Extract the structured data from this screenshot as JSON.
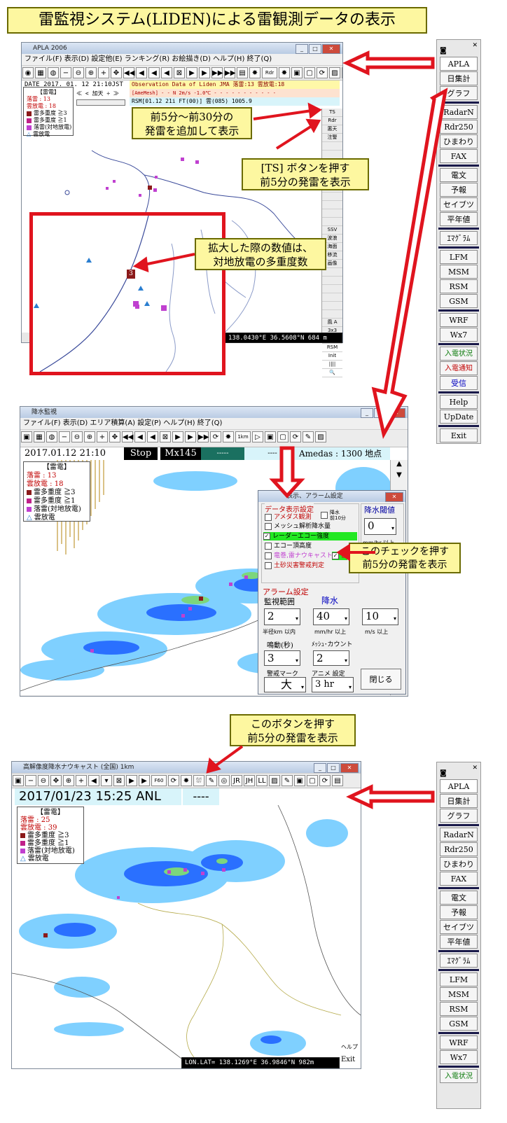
{
  "title": "雷監視システム(LIDEN)による雷観測データの表示",
  "callouts": {
    "past": "前5分〜前30分の\n発雷を追加して表示",
    "ts": "[TS] ボタンを押す\n前5分の発雷を表示",
    "zoom": "拡大した際の数値は、\n対地放電の多重度数",
    "check": "このチェックを押す\n前5分の発雷を表示",
    "button": "このボタンを押す\n前5分の発雷を表示"
  },
  "win1": {
    "title": "APLA 2006",
    "menu": "ファイル(F)  表示(D)  設定他(E)  ランキング(R)  お絵描き(D)  ヘルプ(H)  終了(Q)",
    "toolbar": [
      "◉",
      "▦",
      "◍",
      "−",
      "⊖",
      "⊕",
      "+",
      "✥",
      "◀◀",
      "◀",
      "◀",
      "◀",
      "⊠",
      "▶",
      "▶",
      "▶▶",
      "▶▶",
      "▤",
      "✸",
      "Rdr",
      "✸",
      "▣",
      "▢",
      "⟳",
      "▨",
      "NM"
    ],
    "date": "DATE 2017. 01. 12  21:10JST",
    "obs": "Observation Data of Liden JMA  落雷:13  雲放電:18",
    "amesh": "[AmeMesh]  - -   N    2m/s -1.0℃   - - - -   - - -  - - - -",
    "rsm": "RSM[01.12 21i FT(00)] 雲(085) 1005.9",
    "nav": "≪  <  加天  ÷  ≫",
    "status_left": "RS",
    "status_right": "138.0430°E  36.5608°N        684 m",
    "vbuttons": [
      "TS",
      "Rdr",
      "悪天",
      "注警",
      "",
      "",
      "",
      "",
      "",
      "",
      "",
      "",
      "",
      "",
      "SSV",
      "波浪",
      "海面",
      "移流",
      "画像",
      "",
      "",
      "",
      "",
      "",
      "",
      "風 A",
      "3x3",
      "MSM",
      "RSM",
      "Init",
      "||||",
      "🔍"
    ],
    "zoom_number": "3"
  },
  "legend": {
    "header": "【雷電】",
    "lightning": "落雷 : 13",
    "cloud": "雲放電 : 18",
    "items": [
      "雷多重度 ≧3",
      "雷多重度 ≧1",
      "落雷(対地放電)",
      "雲放電"
    ]
  },
  "legend2": {
    "header": "【雷電】",
    "lightning": "落雷 : 13",
    "cloud": "雲放電 : 18",
    "items": [
      "雷多重度 ≧3",
      "雷多重度 ≧1",
      "落雷(対地放電)",
      "雲放電"
    ]
  },
  "legend3": {
    "header": "【雷電】",
    "lightning": "落雷 : 25",
    "cloud": "雲放電 : 39",
    "items": [
      "雷多重度 ≧3",
      "雷多重度 ≧1",
      "落雷(対地放電)",
      "雲放電"
    ]
  },
  "sidebar_top": [
    "APLA",
    "日集計",
    "グラフ",
    "RadarN",
    "Rdr250",
    "ひまわり",
    "FAX",
    "電文",
    "予報",
    "セイブツ",
    "平年値",
    "ｴﾏｸﾞﾗﾑ",
    "LFM",
    "MSM",
    "RSM",
    "GSM",
    "WRF",
    "Wx7",
    "入電状況",
    "入電通知",
    "受信",
    "Help",
    "UpDate",
    "Exit"
  ],
  "sidebar_bottom": [
    "APLA",
    "日集計",
    "グラフ",
    "RadarN",
    "Rdr250",
    "ひまわり",
    "FAX",
    "電文",
    "予報",
    "セイブツ",
    "平年値",
    "ｴﾏｸﾞﾗﾑ",
    "LFM",
    "MSM",
    "RSM",
    "GSM",
    "WRF",
    "Wx7",
    "入電状況"
  ],
  "win2": {
    "title": "降水監視",
    "menu": "ファイル(F)  表示(D)  エリア積算(A)  設定(P)  ヘルプ(H)  終了(Q)",
    "toolbar": [
      "▣",
      "▦",
      "◍",
      "−",
      "⊖",
      "⊕",
      "+",
      "✥",
      "◀◀",
      "◀",
      "◀",
      "⊠",
      "▶",
      "▶",
      "▶▶",
      "⟳",
      "✸",
      "1km",
      "▷",
      "▣",
      "▢",
      "⟳",
      "✎",
      "▨"
    ],
    "date": "2017.01.12 21:10",
    "stop": "Stop",
    "mx": "Mx145",
    "dashes": "-----",
    "dashes2": "----",
    "amedas": "Amedas : 1300  地点"
  },
  "dlg": {
    "title": "表示、アラーム設定",
    "data_section": "データ表示設定",
    "amedas": "アメダス観測",
    "rain10": "降水\n前10分",
    "mesh": "メッシュ解析降水量",
    "radar": "レーダーエコー強度",
    "echo": "エコー頂高度",
    "tornado": "竜巻,雷ナウキャスト",
    "thunder": "雷",
    "landslide": "土砂災害警戒判定",
    "threshold_label": "降水閾値",
    "threshold_value": "0",
    "threshold_unit": "mm/hr 以上",
    "alarm_section": "アラーム設定",
    "monitor_range": "監視範囲",
    "rain_label": "降水",
    "range_value": "2",
    "range_unit": "半径km 以内",
    "rain_value": "40",
    "rain_unit": "mm/hr 以上",
    "wind_value": "10",
    "wind_unit": "m/s 以上",
    "sound_label": "鳴動(秒)",
    "mesh_count_label": "ﾒｯｼｭ･カウント",
    "sound_value": "3",
    "mesh_count_value": "2",
    "warn_label": "警戒マーク",
    "anime_label": "アニメ 設定",
    "warn_value": "大",
    "anime_value": "3 hr",
    "close": "閉じる"
  },
  "win3": {
    "title": "高解像度降水ナウキャスト (全国) 1km",
    "toolbar": [
      "▣",
      "−",
      "⊖",
      "✥",
      "⊕",
      "+",
      "◀",
      "▾",
      "⊠",
      "▶",
      "▶",
      "F60",
      "⟳",
      "✸",
      "⛆",
      "✎",
      "◎",
      "JR",
      "JH",
      "LL",
      "▨",
      "✎",
      "▣",
      "▢",
      "⟳",
      "▤"
    ],
    "datetime": "2017/01/23 15:25 ANL",
    "dashes": "----",
    "status": "LON.LAT=  138.1269°E  36.9846°N        982m",
    "help": "ヘルプ",
    "exit": "Exit"
  },
  "colors": {
    "title_bg": "#fdf7a0",
    "arrow": "#e0141e",
    "multi3": "#8b1a1a",
    "multi1": "#c0208a",
    "ground": "#c040d0",
    "cloud_discharge": "#2a7ed0",
    "radar_light": "#7fd0ff",
    "radar_mid": "#2a70ff"
  }
}
